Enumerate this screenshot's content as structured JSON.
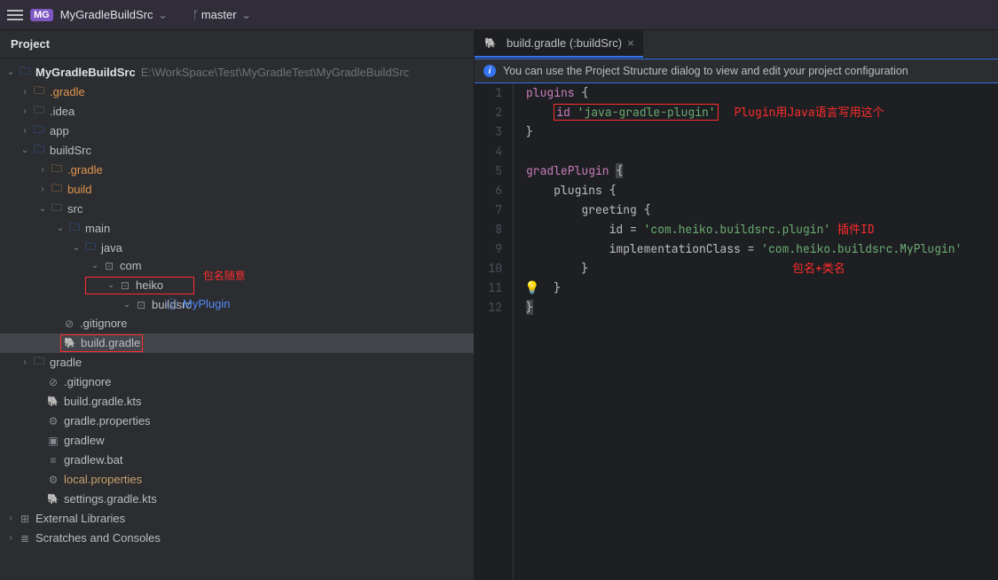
{
  "titlebar": {
    "project_name": "MyGradleBuildSrc",
    "branch": "master"
  },
  "sidebar": {
    "header": "Project",
    "project_root": "MyGradleBuildSrc",
    "project_path": "E:\\WorkSpace\\Test\\MyGradleTest\\MyGradleBuildSrc",
    "gradle_dir": ".gradle",
    "idea_dir": ".idea",
    "app_dir": "app",
    "buildSrc_dir": "buildSrc",
    "buildSrc_gradle": ".gradle",
    "buildSrc_build": "build",
    "src_dir": "src",
    "main_dir": "main",
    "java_dir": "java",
    "pkg_com": "com",
    "pkg_heiko": "heiko",
    "pkg_buildsrc": "buildsrc",
    "class_MyPlugin": "MyPlugin",
    "anno_package": "包名随意",
    "buildSrc_gitignore": ".gitignore",
    "buildSrc_buildgradle": "build.gradle",
    "gradle_dir2": "gradle",
    "root_gitignore": ".gitignore",
    "build_gradle_kts": "build.gradle.kts",
    "gradle_properties": "gradle.properties",
    "gradlew": "gradlew",
    "gradlew_bat": "gradlew.bat",
    "local_properties": "local.properties",
    "settings_gradle_kts": "settings.gradle.kts",
    "external_libs": "External Libraries",
    "scratches": "Scratches and Consoles"
  },
  "editor": {
    "tab_label": "build.gradle (:buildSrc)",
    "banner_text": "You can use the Project Structure dialog to view and edit your project configuration",
    "code": {
      "l1a": "plugins ",
      "l1b": "{",
      "l2a": "    ",
      "l2b": "id ",
      "l2c": "'java-gradle-plugin'",
      "l2anno": "Plugin用Java语言写用这个",
      "l3": "}",
      "l5a": "gradlePlugin ",
      "l5b": "{",
      "l6": "    plugins {",
      "l7": "        greeting {",
      "l8a": "            id = ",
      "l8b": "'com.heiko.buildsrc.plugin'",
      "l8anno": " 插件ID",
      "l9a": "            implementationClass = ",
      "l9b": "'com.heiko.buildsrc.MyPlugin'",
      "l9anno": "包名+类名",
      "l10": "        }",
      "l11": "    }",
      "l12": "}"
    },
    "line_numbers": [
      "1",
      "2",
      "3",
      "4",
      "5",
      "6",
      "7",
      "8",
      "9",
      "10",
      "11",
      "12"
    ]
  }
}
